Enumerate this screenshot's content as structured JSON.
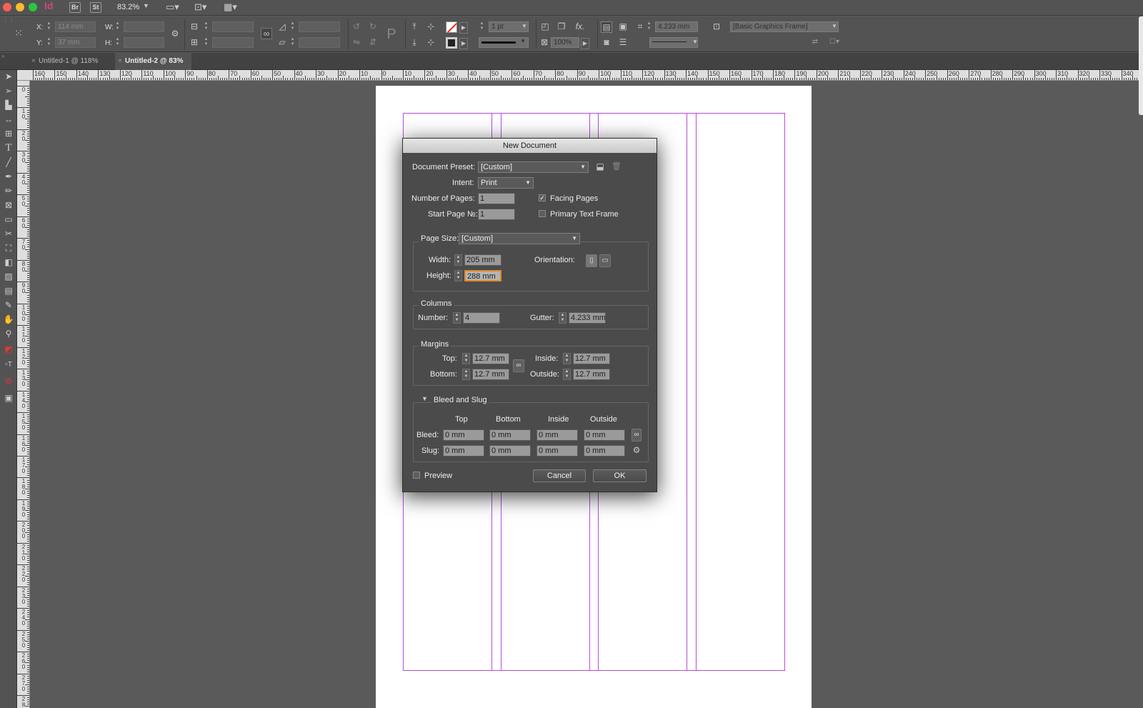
{
  "app": {
    "logo": "Id",
    "bridge": "Br",
    "stock": "St",
    "zoom": "83.2%"
  },
  "control": {
    "x_label": "X:",
    "y_label": "Y:",
    "w_label": "W:",
    "h_label": "H:",
    "x_value": "114 mm",
    "y_value": "37 mm",
    "stroke_weight": "1 pt",
    "opacity": "100%",
    "gutter_value": "4.233 mm",
    "object_style": "[Basic Graphics Frame]"
  },
  "tabs": [
    {
      "label": "Untitled-1 @ 118%",
      "close": "×"
    },
    {
      "label": "Untitled-2 @ 83%",
      "close": "×"
    }
  ],
  "ruler": {
    "h_labels": [
      "160",
      "150",
      "140",
      "130",
      "120",
      "110",
      "100",
      "90",
      "80",
      "70",
      "60",
      "50",
      "40",
      "30",
      "20",
      "10",
      "0",
      "10",
      "20",
      "30",
      "40",
      "50",
      "60",
      "70",
      "80",
      "90",
      "100",
      "110",
      "120",
      "130",
      "140",
      "150",
      "160",
      "170",
      "180",
      "190",
      "200",
      "210",
      "220",
      "230",
      "240",
      "250",
      "260",
      "270",
      "280",
      "290",
      "300",
      "310",
      "320",
      "330",
      "340"
    ],
    "v_labels": [
      "0",
      "10",
      "20",
      "30",
      "40",
      "50",
      "60",
      "70",
      "80",
      "90",
      "100",
      "110",
      "120",
      "130",
      "140",
      "150",
      "160",
      "170",
      "180",
      "190",
      "200",
      "210",
      "220",
      "230",
      "240",
      "250",
      "260",
      "270",
      "280"
    ]
  },
  "dialog": {
    "title": "New Document",
    "preset_label": "Document Preset:",
    "preset_value": "[Custom]",
    "intent_label": "Intent:",
    "intent_value": "Print",
    "pages_label": "Number of Pages:",
    "pages_value": "1",
    "start_label": "Start Page №:",
    "start_value": "1",
    "facing_label": "Facing Pages",
    "facing_checked": true,
    "primary_label": "Primary Text Frame",
    "primary_checked": false,
    "pagesize_label": "Page Size:",
    "pagesize_value": "[Custom]",
    "width_label": "Width:",
    "width_value": "205 mm",
    "height_label": "Height:",
    "height_value": "288 mm",
    "orientation_label": "Orientation:",
    "columns_title": "Columns",
    "col_number_label": "Number:",
    "col_number_value": "4",
    "gutter_label": "Gutter:",
    "gutter_value": "4.233 mm",
    "margins_title": "Margins",
    "m_top_label": "Top:",
    "m_top_value": "12.7 mm",
    "m_bottom_label": "Bottom:",
    "m_bottom_value": "12.7 mm",
    "m_inside_label": "Inside:",
    "m_inside_value": "12.7 mm",
    "m_outside_label": "Outside:",
    "m_outside_value": "12.7 mm",
    "bleed_title": "Bleed and Slug",
    "col_top": "Top",
    "col_bottom": "Bottom",
    "col_inside": "Inside",
    "col_outside": "Outside",
    "bleed_label": "Bleed:",
    "slug_label": "Slug:",
    "bleed_values": [
      "0 mm",
      "0 mm",
      "0 mm",
      "0 mm"
    ],
    "slug_values": [
      "0 mm",
      "0 mm",
      "0 mm",
      "0 mm"
    ],
    "preview_label": "Preview",
    "cancel_label": "Cancel",
    "ok_label": "OK"
  }
}
